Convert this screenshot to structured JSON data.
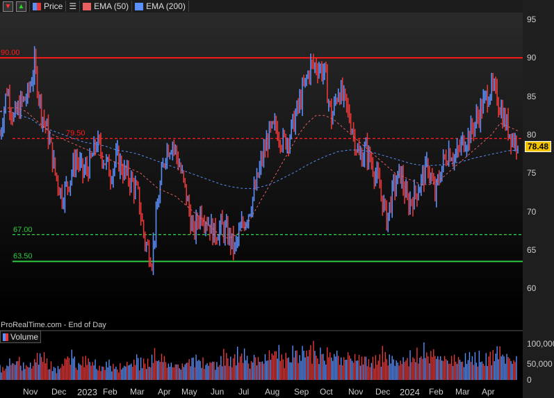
{
  "toolbar": {
    "price_label": "Price",
    "ema50_label": "EMA (50)",
    "ema200_label": "EMA (200)"
  },
  "footer": {
    "source": "ProRealTime.com - End of Day",
    "volume_label": "Volume"
  },
  "colors": {
    "up": "#5b8ff9",
    "down": "#e8393a",
    "ema50": "#e86060",
    "ema200": "#5b8ff9",
    "resistance": "#ff1a1a",
    "support": "#2ecc40",
    "price_tag": "#f5c400"
  },
  "chart_data": [
    {
      "type": "candlestick",
      "title": "Price",
      "ylim": [
        55,
        97
      ],
      "yticks": [
        "95",
        "90",
        "85",
        "80",
        "75",
        "70",
        "65",
        "60"
      ],
      "x_labels": [
        "Nov",
        "Dec",
        "2023",
        "Feb",
        "Mar",
        "Apr",
        "May",
        "Jun",
        "Jul",
        "Aug",
        "Sep",
        "Oct",
        "Nov",
        "Dec",
        "2024",
        "Feb",
        "Mar",
        "Apr"
      ],
      "closes": [
        80,
        86,
        82,
        84,
        85,
        89,
        83,
        80,
        75,
        72,
        74,
        77,
        75,
        76,
        79,
        77,
        75,
        77,
        75,
        74,
        72,
        66,
        64,
        72,
        78,
        79,
        76,
        72,
        67,
        70,
        69,
        67,
        68,
        67,
        65,
        68,
        70,
        73,
        77,
        80,
        81,
        79,
        80,
        83,
        86,
        89,
        89,
        88,
        82,
        86,
        84,
        81,
        77,
        78,
        76,
        73,
        69,
        73,
        75,
        71,
        72,
        74,
        76,
        72,
        76,
        78,
        77,
        79,
        80,
        82,
        84,
        86,
        85,
        82,
        80,
        78.48
      ],
      "ema50": [
        83,
        83.5,
        83.5,
        83,
        82,
        81,
        80,
        79.5,
        79,
        78.5,
        78,
        77.5,
        77,
        76.5,
        76,
        75.5,
        75,
        74,
        73,
        72.5,
        72,
        71,
        70,
        69,
        68,
        67,
        66.5,
        67,
        68,
        70,
        72,
        74,
        76,
        78,
        80,
        81.5,
        82.5,
        82.5,
        82,
        81,
        80,
        79,
        78,
        77,
        76,
        75,
        74.5,
        74,
        73.5,
        73.5,
        74,
        75,
        76,
        77,
        78,
        79,
        80,
        81.5,
        81,
        80.5
      ],
      "ema200": [
        83,
        83,
        82.5,
        82,
        81,
        80.5,
        80,
        79.5,
        79,
        78.8,
        78.5,
        78,
        77.8,
        77.5,
        77,
        76.5,
        76,
        75.5,
        75,
        74.5,
        74,
        73.5,
        73.2,
        73,
        73,
        73.3,
        73.8,
        74.5,
        75.2,
        76,
        76.7,
        77.3,
        77.8,
        78,
        78,
        77.8,
        77.4,
        77,
        76.6,
        76.2,
        76,
        76,
        76.1,
        76.3,
        76.6,
        77,
        77.3,
        77.6,
        77.9,
        78
      ],
      "horizontal_lines": [
        {
          "value": 90,
          "label": "90.00",
          "style": "solid",
          "color": "#ff1a1a"
        },
        {
          "value": 79.5,
          "label": "79.50",
          "style": "dashed",
          "color": "#ff1a1a"
        },
        {
          "value": 67,
          "label": "67.00",
          "style": "dashed",
          "color": "#2ecc40"
        },
        {
          "value": 63.5,
          "label": "63.50",
          "style": "solid",
          "color": "#2ecc40"
        }
      ],
      "last_price": "78.48"
    },
    {
      "type": "bar",
      "title": "Volume",
      "ylim": [
        0,
        135000
      ],
      "yticks": [
        "100,000",
        "50,000",
        "0"
      ],
      "values": [
        30,
        38,
        45,
        40,
        35,
        55,
        50,
        32,
        30,
        48,
        60,
        35,
        45,
        42,
        30,
        38,
        32,
        28,
        40,
        48,
        42,
        35,
        55,
        60,
        42,
        38,
        35,
        48,
        45,
        40,
        42,
        38,
        50,
        45,
        62,
        55,
        48,
        52,
        45,
        58,
        60,
        50,
        55,
        62,
        72,
        68,
        60,
        58,
        55,
        52,
        62,
        55,
        48,
        45,
        50,
        55,
        48,
        42,
        45,
        52,
        60,
        68,
        58,
        60,
        55,
        50,
        52,
        48,
        55,
        50,
        45,
        58,
        65,
        55,
        48
      ]
    }
  ]
}
